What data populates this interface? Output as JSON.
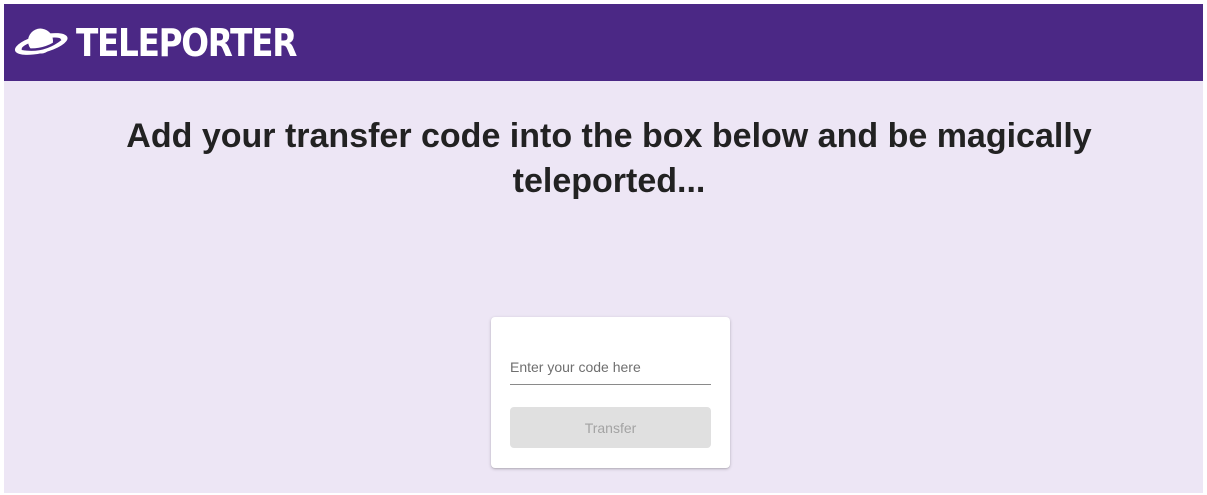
{
  "header": {
    "brand": "TELEPORTER",
    "logo_icon": "planet-icon",
    "background_color": "#4b2885"
  },
  "main": {
    "headline": "Add your transfer code into the box below and be magically teleported...",
    "background_color": "#ede6f5"
  },
  "form": {
    "code_placeholder": "Enter your code here",
    "code_value": "",
    "transfer_label": "Transfer",
    "transfer_disabled": true
  }
}
